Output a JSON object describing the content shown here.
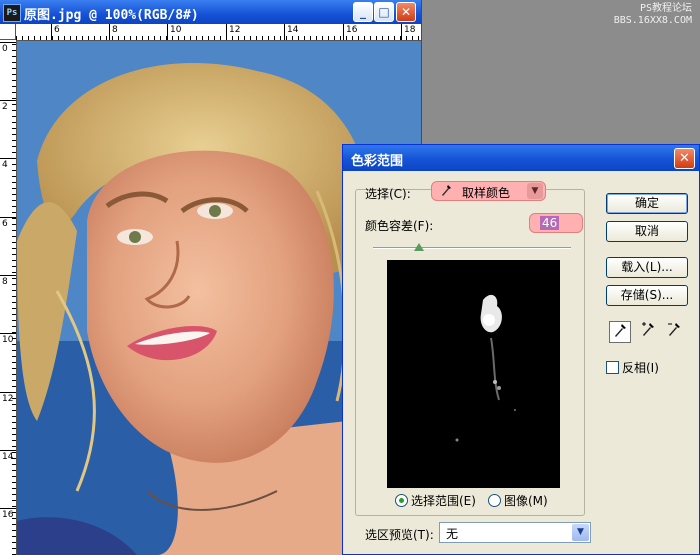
{
  "document_window": {
    "title": "原图.jpg @ 100%(RGB/8#)",
    "app_icon_text": "Ps",
    "controls": {
      "minimize": "_",
      "maximize": "□",
      "close": "✕"
    },
    "ruler_top_numbers": [
      "6",
      "8",
      "10",
      "12",
      "14",
      "16",
      "18"
    ],
    "ruler_left_numbers": [
      "0",
      "2",
      "4",
      "6",
      "8",
      "10",
      "12",
      "14",
      "16"
    ]
  },
  "watermark": {
    "line1": "PS教程论坛",
    "line2": "BBS.16XX8.COM"
  },
  "dialog": {
    "title": "色彩范围",
    "close": "✕",
    "select_label": "选择(C):",
    "select_value": "取样颜色",
    "select_icon": "eyedropper-icon",
    "fuzziness_label": "颜色容差(F):",
    "fuzziness_value": "46",
    "fuzziness_level": 0.23,
    "radio_selection": "选择范围(E)",
    "radio_image": "图像(M)",
    "buttons": {
      "ok": "确定",
      "cancel": "取消",
      "load": "载入(L)...",
      "save": "存储(S)..."
    },
    "invert_label": "反相(I)",
    "preview_label": "选区预览(T):",
    "preview_value": "无",
    "highlight_color": "#ffb0b0"
  }
}
